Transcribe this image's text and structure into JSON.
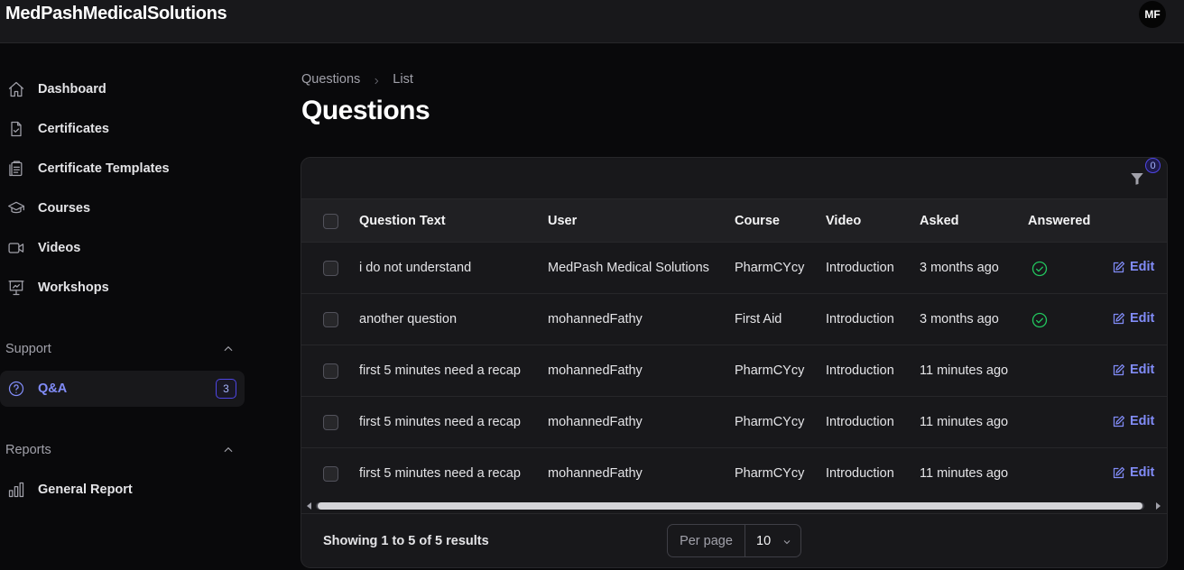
{
  "app": {
    "brand": "MedPashMedicalSolutions",
    "avatar_initials": "MF"
  },
  "sidebar": {
    "items": [
      {
        "label": "Dashboard",
        "icon": "home-icon"
      },
      {
        "label": "Certificates",
        "icon": "document-check-icon"
      },
      {
        "label": "Certificate Templates",
        "icon": "clipboard-icon"
      },
      {
        "label": "Courses",
        "icon": "academic-cap-icon"
      },
      {
        "label": "Videos",
        "icon": "video-camera-icon"
      },
      {
        "label": "Workshops",
        "icon": "presentation-icon"
      }
    ],
    "groups": [
      {
        "label": "Support",
        "items": [
          {
            "label": "Q&A",
            "icon": "question-circle-icon",
            "badge": "3",
            "active": true
          }
        ]
      },
      {
        "label": "Reports",
        "items": [
          {
            "label": "General Report",
            "icon": "chart-bar-icon"
          }
        ]
      }
    ]
  },
  "breadcrumb": {
    "parent": "Questions",
    "current": "List"
  },
  "page_title": "Questions",
  "filter": {
    "count": "0",
    "icon": "funnel-icon"
  },
  "table": {
    "columns": [
      "Question Text",
      "User",
      "Course",
      "Video",
      "Asked",
      "Answered"
    ],
    "rows": [
      {
        "question": "i do not understand",
        "user": "MedPash Medical Solutions",
        "course": "PharmCYcy",
        "video": "Introduction",
        "asked": "3 months ago",
        "answered": true,
        "action": "Edit"
      },
      {
        "question": "another question",
        "user": "mohannedFathy",
        "course": "First Aid",
        "video": "Introduction",
        "asked": "3 months ago",
        "answered": true,
        "action": "Edit"
      },
      {
        "question": "first 5 minutes need a recap",
        "user": "mohannedFathy",
        "course": "PharmCYcy",
        "video": "Introduction",
        "asked": "11 minutes ago",
        "answered": false,
        "action": "Edit"
      },
      {
        "question": "first 5 minutes need a recap",
        "user": "mohannedFathy",
        "course": "PharmCYcy",
        "video": "Introduction",
        "asked": "11 minutes ago",
        "answered": false,
        "action": "Edit"
      },
      {
        "question": "first 5 minutes need a recap",
        "user": "mohannedFathy",
        "course": "PharmCYcy",
        "video": "Introduction",
        "asked": "11 minutes ago",
        "answered": false,
        "action": "Edit"
      }
    ]
  },
  "pagination": {
    "summary": "Showing 1 to 5 of 5 results",
    "per_page_label": "Per page",
    "per_page_value": "10"
  },
  "colors": {
    "accent": "#818cf8",
    "success": "#22c55e",
    "background": "#09090b",
    "surface": "#18181b"
  }
}
